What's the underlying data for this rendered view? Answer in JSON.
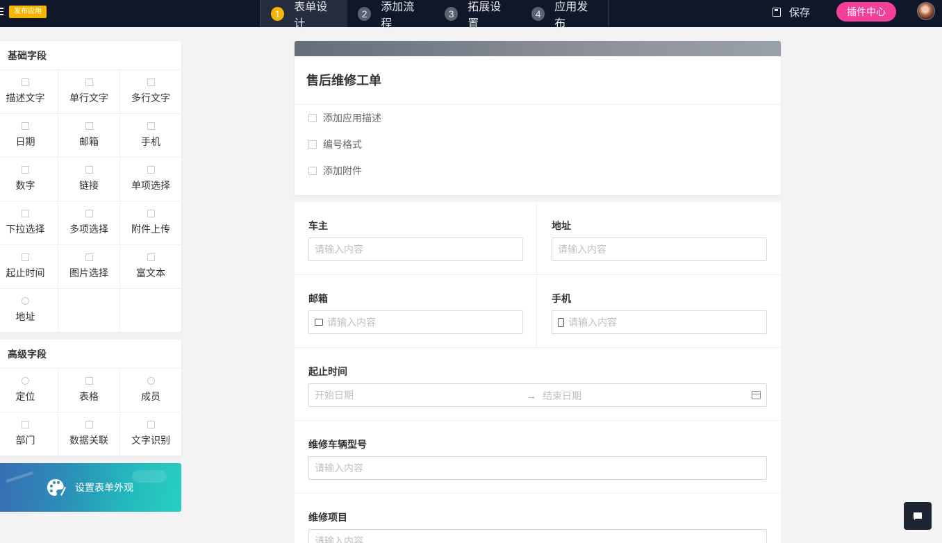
{
  "topbar": {
    "publish_badge": "发布应用",
    "steps": [
      {
        "num": "1",
        "label": "表单设计"
      },
      {
        "num": "2",
        "label": "添加流程"
      },
      {
        "num": "3",
        "label": "拓展设置"
      },
      {
        "num": "4",
        "label": "应用发布"
      }
    ],
    "save_label": "保存",
    "plugin_label": "插件中心"
  },
  "sidebar": {
    "basic_title": "基础字段",
    "basic_fields": [
      "描述文字",
      "单行文字",
      "多行文字",
      "日期",
      "邮箱",
      "手机",
      "数字",
      "链接",
      "单项选择",
      "下拉选择",
      "多项选择",
      "附件上传",
      "起止时间",
      "图片选择",
      "富文本",
      "地址"
    ],
    "advanced_title": "高级字段",
    "advanced_fields": [
      "定位",
      "表格",
      "成员",
      "部门",
      "数据关联",
      "文字识别"
    ],
    "appearance_label": "设置表单外观"
  },
  "form": {
    "title": "售后维修工单",
    "meta": [
      "添加应用描述",
      "编号格式",
      "添加附件"
    ],
    "fields": {
      "owner_label": "车主",
      "address_label": "地址",
      "email_label": "邮箱",
      "phone_label": "手机",
      "time_label": "起止时间",
      "model_label": "维修车辆型号",
      "item_label": "维修项目",
      "placeholder": "请输入内容",
      "start_placeholder": "开始日期",
      "end_placeholder": "结束日期",
      "arrow": "→"
    }
  },
  "colors": {
    "topbar": "#10172a",
    "accent_yellow": "#f7b500",
    "plugin_pink": "#f43f9b"
  }
}
